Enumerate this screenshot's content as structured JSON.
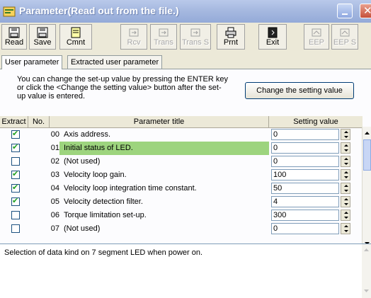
{
  "window": {
    "title": "Parameter(Read out from the file.)"
  },
  "toolbar": {
    "buttons": [
      {
        "label": "Read",
        "icon": "disk-icon",
        "enabled": true
      },
      {
        "label": "Save",
        "icon": "disk-icon",
        "enabled": true
      },
      {
        "label": "Cmnt",
        "icon": "note-icon",
        "enabled": true
      },
      {
        "label": "Rcv",
        "icon": "transfer-icon",
        "enabled": false
      },
      {
        "label": "Trans",
        "icon": "transfer-icon",
        "enabled": false
      },
      {
        "label": "Trans S",
        "icon": "transfer-icon",
        "enabled": false
      },
      {
        "label": "Prnt",
        "icon": "printer-icon",
        "enabled": true
      },
      {
        "label": "Exit",
        "icon": "exit-icon",
        "enabled": true
      },
      {
        "label": "EEP",
        "icon": "eep-icon",
        "enabled": false
      },
      {
        "label": "EEP S",
        "icon": "eep-icon",
        "enabled": false
      }
    ]
  },
  "tabs": [
    {
      "label": "User parameter",
      "active": true
    },
    {
      "label": "Extracted user parameter",
      "active": false
    }
  ],
  "info": {
    "text": "You can change the set-up value by pressing the ENTER key or click the <Change the setting value> button after the set-up value is entered.",
    "change_button": "Change the setting value"
  },
  "grid": {
    "columns": [
      "Extract",
      "No.",
      "Parameter title",
      "Setting value"
    ],
    "rows": [
      {
        "checked": true,
        "no": "00",
        "title": "Axis address.",
        "value": "0",
        "highlight": false
      },
      {
        "checked": true,
        "no": "01",
        "title": "Initial status of LED.",
        "value": "0",
        "highlight": true
      },
      {
        "checked": false,
        "no": "02",
        "title": "(Not used)",
        "value": "0",
        "highlight": false
      },
      {
        "checked": true,
        "no": "03",
        "title": "Velocity loop gain.",
        "value": "100",
        "highlight": false
      },
      {
        "checked": true,
        "no": "04",
        "title": "Velocity loop integration time constant.",
        "value": "50",
        "highlight": false
      },
      {
        "checked": true,
        "no": "05",
        "title": "Velocity detection filter.",
        "value": "4",
        "highlight": false
      },
      {
        "checked": false,
        "no": "06",
        "title": "Torque limitation set-up.",
        "value": "300",
        "highlight": false
      },
      {
        "checked": false,
        "no": "07",
        "title": "(Not used)",
        "value": "0",
        "highlight": false
      }
    ]
  },
  "description": "Selection of data kind on 7 segment LED when power on.",
  "colors": {
    "highlight": "#9dd47e",
    "titlebar": "#a6b9e0",
    "check": "#21a121"
  }
}
